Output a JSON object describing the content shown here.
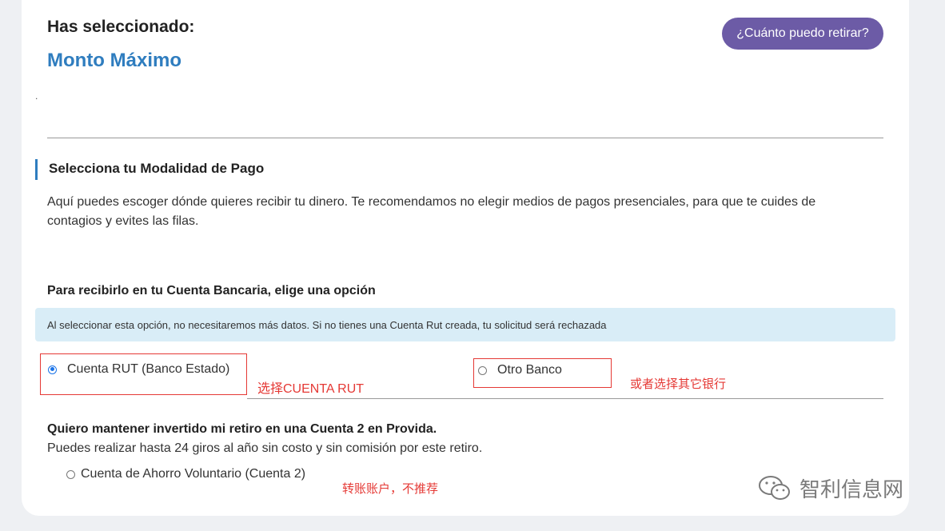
{
  "header": {
    "selected_label": "Has seleccionado:",
    "selected_value": "Monto Máximo",
    "how_much_button": "¿Cuánto puedo retirar?",
    "dot": "."
  },
  "payment": {
    "title": "Selecciona tu Modalidad de Pago",
    "description": "Aquí puedes escoger dónde quieres recibir tu dinero. Te recomendamos no elegir medios de pagos presenciales, para que te cuides de contagios y evites las filas."
  },
  "bank_account": {
    "title": "Para recibirlo en tu Cuenta Bancaria, elige una opción",
    "info": "Al seleccionar esta opción, no necesitaremos más datos. Si no tienes una Cuenta Rut creada, tu solicitud será rechazada",
    "options": [
      {
        "label": "Cuenta RUT (Banco Estado)",
        "selected": true
      },
      {
        "label": "Otro Banco",
        "selected": false
      }
    ]
  },
  "annotations": {
    "choose_rut": "选择CUENTA RUT",
    "other_bank": "或者选择其它银行",
    "not_recommended": "转账账户，不推荐"
  },
  "invest": {
    "title": "Quiero mantener invertido mi retiro en una Cuenta 2 en Provida.",
    "description": "Puedes realizar hasta 24 giros al año sin costo y sin comisión por este retiro.",
    "option": {
      "label": "Cuenta de Ahorro Voluntario (Cuenta 2)",
      "selected": false
    }
  },
  "watermark": {
    "text": "智利信息网",
    "icon": "wechat-icon"
  },
  "colors": {
    "accent": "#2f7dbf",
    "button": "#6c5ba6",
    "info_bg": "#d9edf7",
    "annotation": "#e53935"
  }
}
